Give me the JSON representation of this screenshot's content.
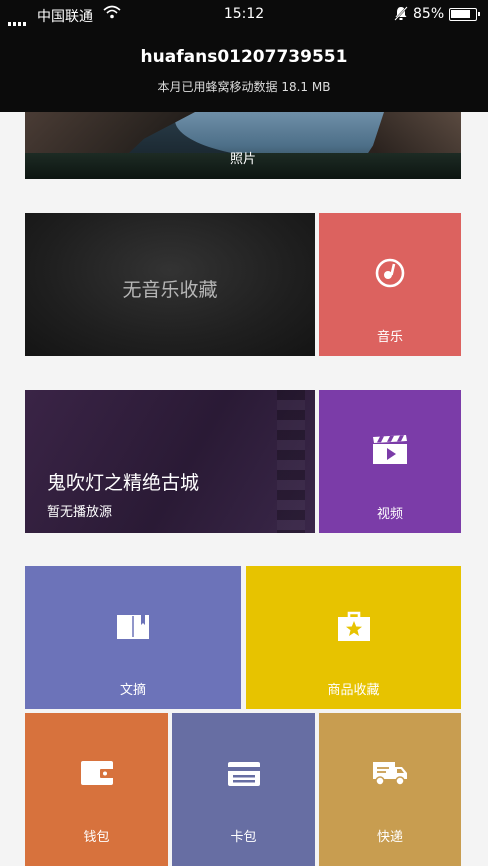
{
  "status_bar": {
    "carrier": "中国联通",
    "time": "15:12",
    "battery": "85%",
    "battery_level": 0.85
  },
  "header": {
    "username": "huafans01207739551",
    "data_usage": "本月已用蜂窝移动数据 18.1 MB"
  },
  "photos": {
    "label": "照片"
  },
  "music": {
    "empty_text": "无音乐收藏",
    "label": "音乐"
  },
  "video": {
    "title": "鬼吹灯之精绝古城",
    "subtitle": "暂无播放源",
    "label": "视频"
  },
  "tiles": {
    "digest": "文摘",
    "favorites": "商品收藏",
    "wallet": "钱包",
    "cards": "卡包",
    "express": "快递"
  },
  "colors": {
    "music": "#dc625f",
    "video": "#7b3ca8",
    "digest": "#6c73b9",
    "favorites": "#e7c300",
    "wallet": "#d7723d",
    "cards": "#676ea3",
    "express": "#c89d50"
  },
  "icons": {
    "music": "music-disc-icon",
    "video": "clapperboard-icon",
    "digest": "open-book-icon",
    "favorites": "star-bag-icon",
    "wallet": "wallet-icon",
    "cards": "card-icon",
    "express": "truck-icon"
  }
}
